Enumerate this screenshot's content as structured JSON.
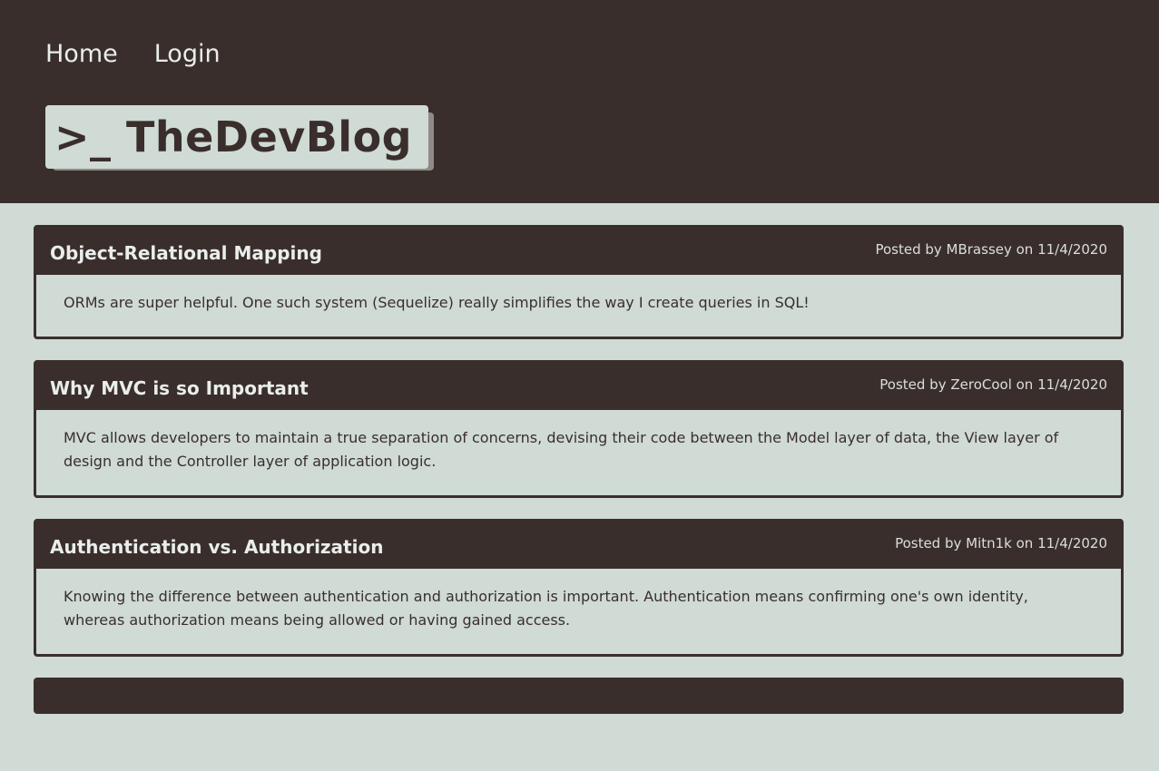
{
  "nav": {
    "home_label": "Home",
    "login_label": "Login"
  },
  "logo": {
    "text": ">_ TheDevBlog"
  },
  "posts": [
    {
      "title": "Object-Relational Mapping",
      "meta": "Posted by MBrassey on 11/4/2020",
      "body": "ORMs are super helpful. One such system (Sequelize) really simplifies the way I create queries in SQL!"
    },
    {
      "title": "Why MVC is so Important",
      "meta": "Posted by ZeroCool on 11/4/2020",
      "body": "MVC allows developers to maintain a true separation of concerns, devising their code between the Model layer of data, the View layer of design and the Controller layer of application logic."
    },
    {
      "title": "Authentication vs. Authorization",
      "meta": "Posted by Mitn1k on 11/4/2020",
      "body": "Knowing the difference between authentication and authorization is important. Authentication means confirming one's own identity, whereas authorization means being allowed or having gained access."
    }
  ],
  "colors": {
    "header_bg": "#3a2e2d",
    "page_bg": "#cfdbd4",
    "text_light": "#e9eeea"
  }
}
